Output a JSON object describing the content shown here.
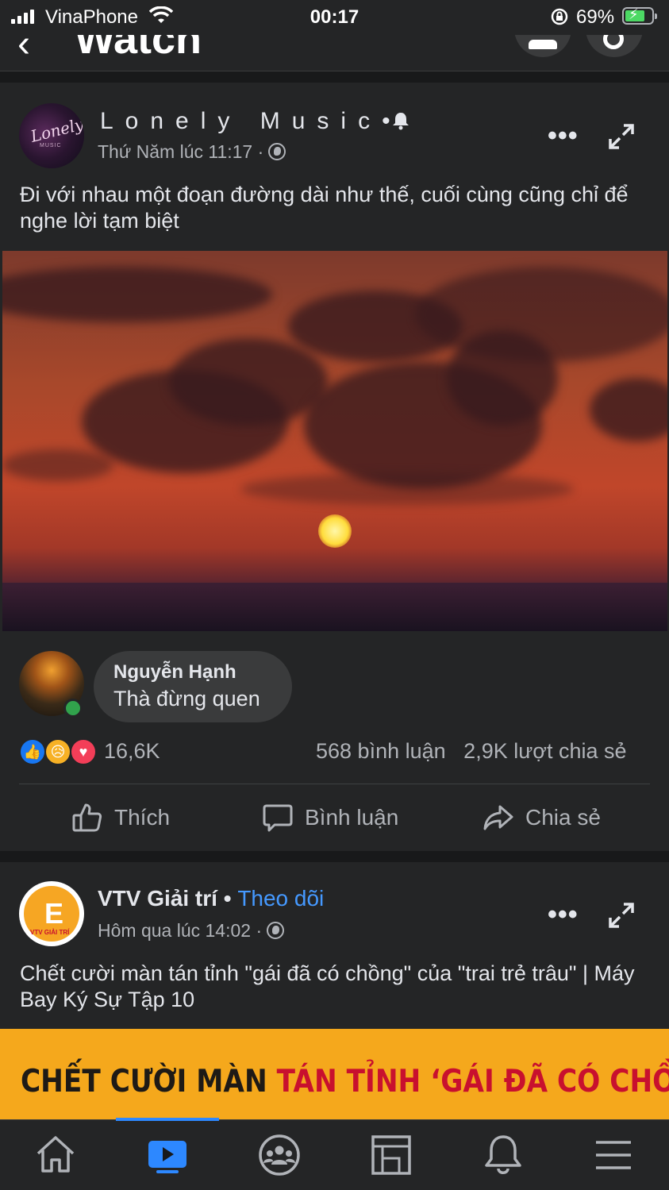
{
  "status_bar": {
    "carrier": "VinaPhone",
    "time": "00:17",
    "battery_percent": "69%",
    "battery_level": 0.69,
    "charging": true
  },
  "header": {
    "title": "Watch",
    "icons": [
      "back-icon",
      "profile-icon",
      "search-icon"
    ]
  },
  "posts": [
    {
      "author": "Lonely Music",
      "author_suffix": "•",
      "timestamp": "Thứ Năm lúc 11:17 ·",
      "caption": "Đi với nhau một đoạn đường dài như thế, cuối cùng cũng chỉ để nghe lời tạm biệt",
      "avatar_text": "Lonely",
      "avatar_subtext": "MUSIC",
      "top_comment": {
        "name": "Nguyễn Hạnh",
        "text": "Thà đừng quen"
      },
      "reactions": {
        "types": [
          "like",
          "sad",
          "love"
        ],
        "total": "16,6K",
        "comments": "568 bình luận",
        "shares": "2,9K lượt chia sẻ"
      },
      "actions": {
        "like": "Thích",
        "comment": "Bình luận",
        "share": "Chia sẻ"
      }
    },
    {
      "author": "VTV Giải trí",
      "separator": "•",
      "follow_label": "Theo dõi",
      "timestamp": "Hôm qua lúc 14:02 ·",
      "caption": "Chết cười màn tán tỉnh \"gái đã có chồng\" của \"trai trẻ trâu\" | Máy Bay Ký Sự Tập 10",
      "avatar_text": "VTV GIẢI TRÍ",
      "thumbnail_text_dark": "CHẾT CƯỜI MÀN ",
      "thumbnail_text_red": "TÁN TỈNH ‘GÁI ĐÃ CÓ CHỒNG’"
    }
  ],
  "tab_bar": {
    "tabs": [
      "home-icon",
      "watch-icon",
      "groups-icon",
      "pages-icon",
      "notifications-icon",
      "menu-icon"
    ],
    "active_tab": "watch-icon"
  },
  "colors": {
    "background": "#18191a",
    "card": "#242526",
    "accent": "#2d88ff",
    "follow_link": "#4599ff",
    "online": "#31a24c"
  }
}
